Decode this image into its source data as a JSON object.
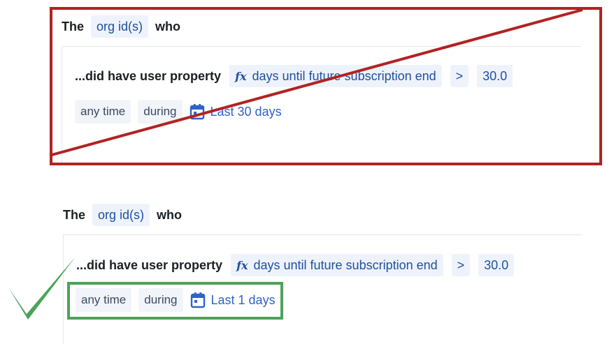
{
  "top": {
    "the": "The",
    "entity": "org id(s)",
    "who": "who",
    "clause": "...did have user property",
    "fx": "fx",
    "property": "days until future subscription end",
    "operator": ">",
    "value": "30.0",
    "timing": "any time",
    "during": "during",
    "range": "Last 30 days"
  },
  "bottom": {
    "the": "The",
    "entity": "org id(s)",
    "who": "who",
    "clause": "...did have user property",
    "fx": "fx",
    "property": "days until future subscription end",
    "operator": ">",
    "value": "30.0",
    "timing": "any time",
    "during": "during",
    "range": "Last 1 days"
  },
  "colors": {
    "wrong_mark": "#b22222",
    "correct_mark": "#4da25a",
    "chip_text": "#1f4fa3"
  },
  "icons": [
    "calendar-icon",
    "checkmark-icon",
    "cross-icon"
  ]
}
